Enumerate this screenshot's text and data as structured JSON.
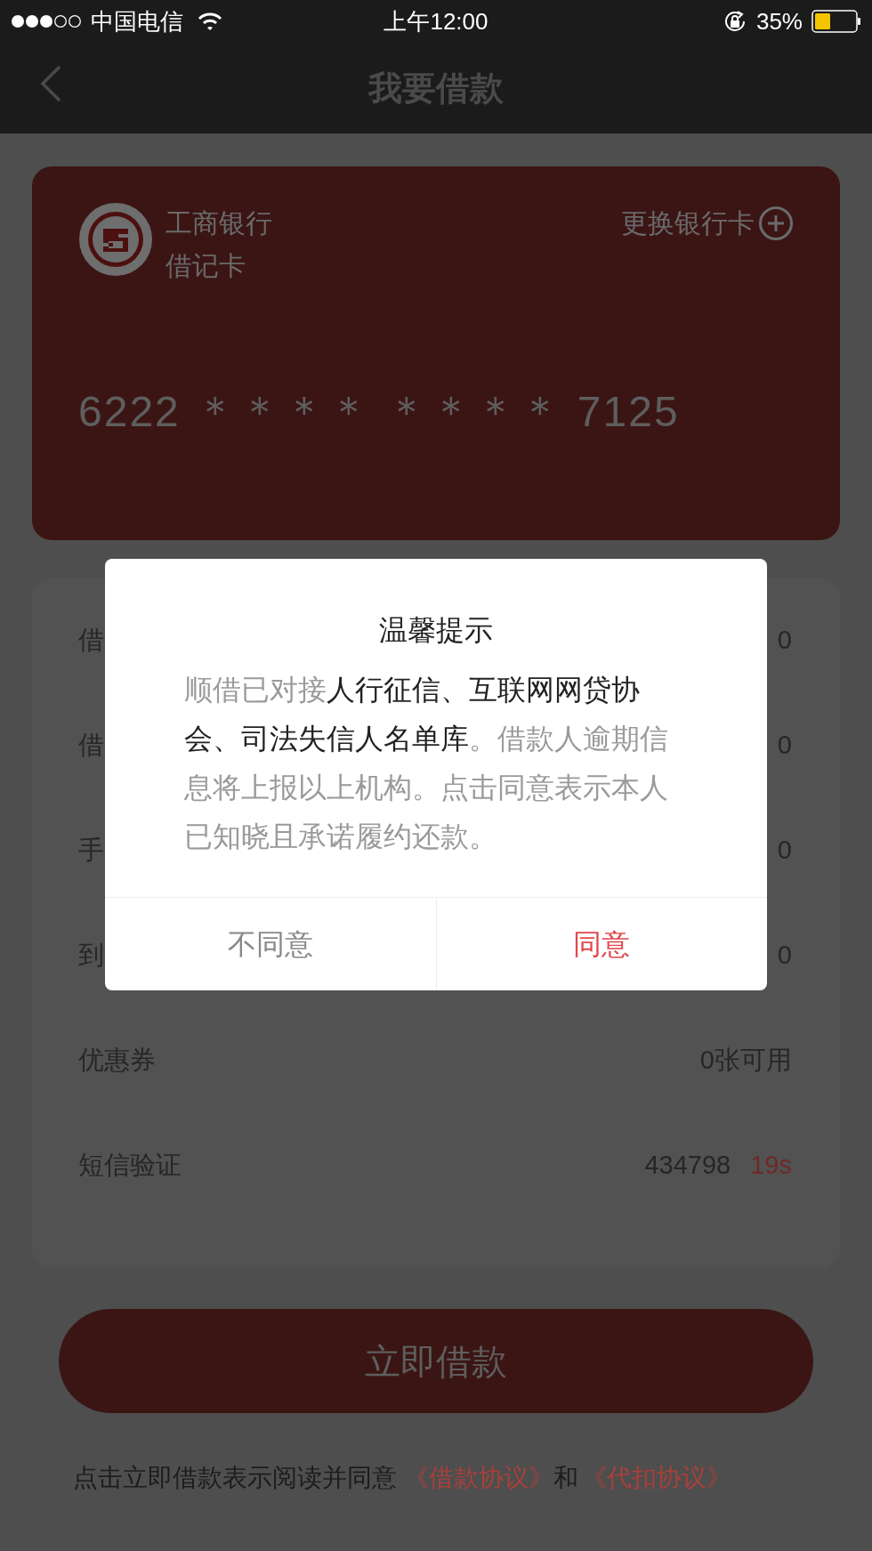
{
  "status_bar": {
    "carrier": "中国电信",
    "time": "上午12:00",
    "battery": "35%"
  },
  "nav": {
    "title": "我要借款"
  },
  "card": {
    "bank": "工商银行",
    "type": "借记卡",
    "change": "更换银行卡",
    "number": "6222 ＊＊＊＊ ＊＊＊＊ 7125"
  },
  "rows": [
    {
      "label": "借",
      "value": "0"
    },
    {
      "label": "借",
      "value": "0"
    },
    {
      "label": "手",
      "value": "0"
    },
    {
      "label": "到",
      "value": "0"
    },
    {
      "label": "优惠券",
      "value": "0张可用"
    },
    {
      "label": "短信验证",
      "value": "434798",
      "countdown": "19s"
    }
  ],
  "submit": "立即借款",
  "agreement": {
    "text": "点击立即借款表示阅读并同意",
    "links": [
      "《借款协议》",
      "《代扣协议》"
    ],
    "joiner": "和"
  },
  "dialog": {
    "title": "温馨提示",
    "body": [
      {
        "text": "顺借已对接",
        "emphasis": false
      },
      {
        "text": "人行征信、互联网网贷协会、司法失信人名单库",
        "emphasis": true
      },
      {
        "text": "。借款人逾期信息将上报以上机构。点击同意表示本人已知晓且承诺履约还款。",
        "emphasis": false
      }
    ],
    "buttons": [
      {
        "label": "不同意",
        "kind": "cancel"
      },
      {
        "label": "同意",
        "kind": "confirm"
      }
    ]
  }
}
